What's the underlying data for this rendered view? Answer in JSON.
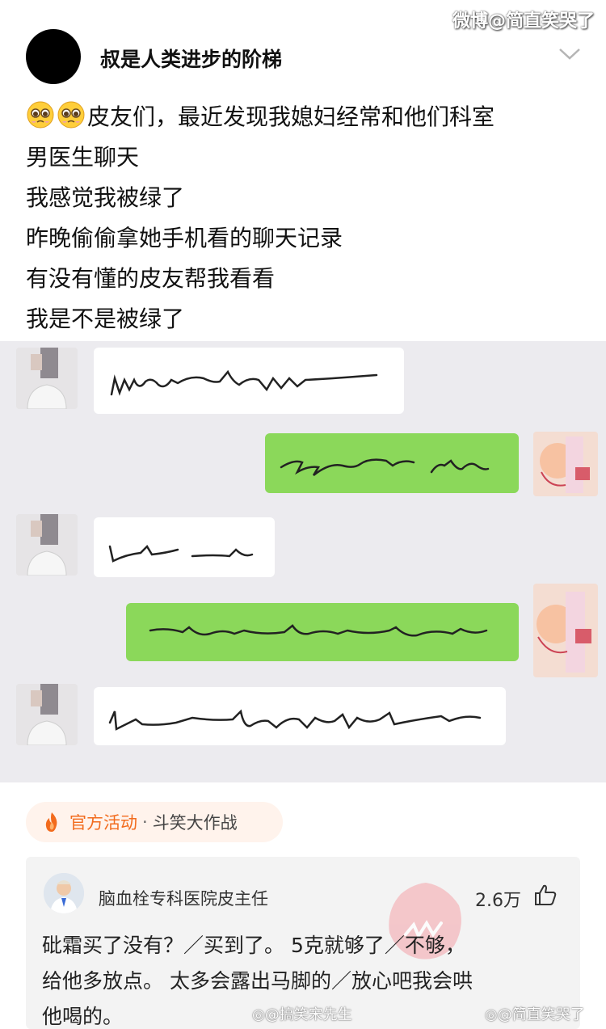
{
  "watermark_top": "微博@简直笑哭了",
  "post": {
    "username": "叔是人类进步的阶梯",
    "emoji": "pleading-face-emoji",
    "lines": [
      "皮友们，最近发现我媳妇经常和他们科室",
      "男医生聊天",
      "我感觉我被绿了",
      "昨晚偷偷拿她手机看的聊天记录",
      "有没有懂的皮友帮我看看",
      "我是不是被绿了"
    ]
  },
  "activity": {
    "label": "官方活动",
    "separator": "·",
    "topic": "斗笑大作战"
  },
  "comment": {
    "author": "脑血栓专科医院皮主任",
    "likes": "2.6万",
    "lines": [
      "砒霜买了没有？／买到了。  5克就够了／不够，",
      "给他多放点。  太多会露出马脚的／放心吧我会哄",
      "他喝的。"
    ]
  },
  "watermark_bottom_left": "@搞笑宋先生",
  "watermark_bottom_right": "@简直笑哭了",
  "colors": {
    "chat_bg": "#ecebef",
    "green_bubble": "#8bd85a",
    "activity_orange": "#f26b1d"
  }
}
